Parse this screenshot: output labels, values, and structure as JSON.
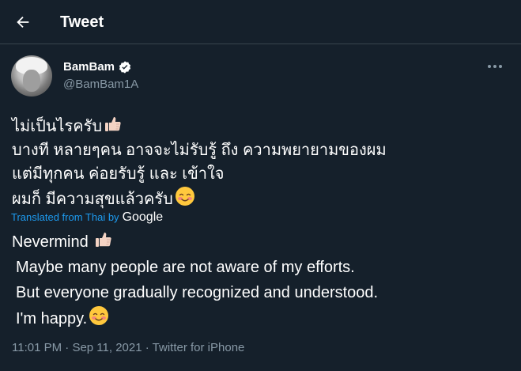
{
  "header": {
    "title": "Tweet",
    "back_icon": "arrow-left-icon"
  },
  "author": {
    "display_name": "BamBam",
    "handle": "@BamBam1A",
    "verified_icon": "verified-badge-icon",
    "verified_color": "#ffffff"
  },
  "more_icon": "more-horizontal-icon",
  "tweet": {
    "thai_lines": [
      "ไม่เป็นไรครับ",
      "บางที หลายๆคน อาจจะไม่รับรู้ ถึง ความพยายามของผม",
      "แต่มีทุกคน ค่อยรับรู้ และ เข้าใจ",
      "ผมก็ มีความสุขแล้วครับ"
    ],
    "translation": {
      "prefix": "Translated from Thai by",
      "provider": "Google"
    },
    "english_lines": [
      "Nevermind",
      "Maybe many people are not aware of my efforts.",
      "But everyone gradually recognized and understood.",
      "I'm happy."
    ],
    "emojis": [
      "thumbs-up-icon",
      "smiling-face-icon"
    ]
  },
  "meta": {
    "time": "11:01 PM",
    "separator": "·",
    "date": "Sep 11, 2021",
    "client": "Twitter for iPhone"
  },
  "colors": {
    "background": "#15202b",
    "border": "#38444d",
    "secondary_text": "#8899a6",
    "link": "#1d9bf0"
  }
}
